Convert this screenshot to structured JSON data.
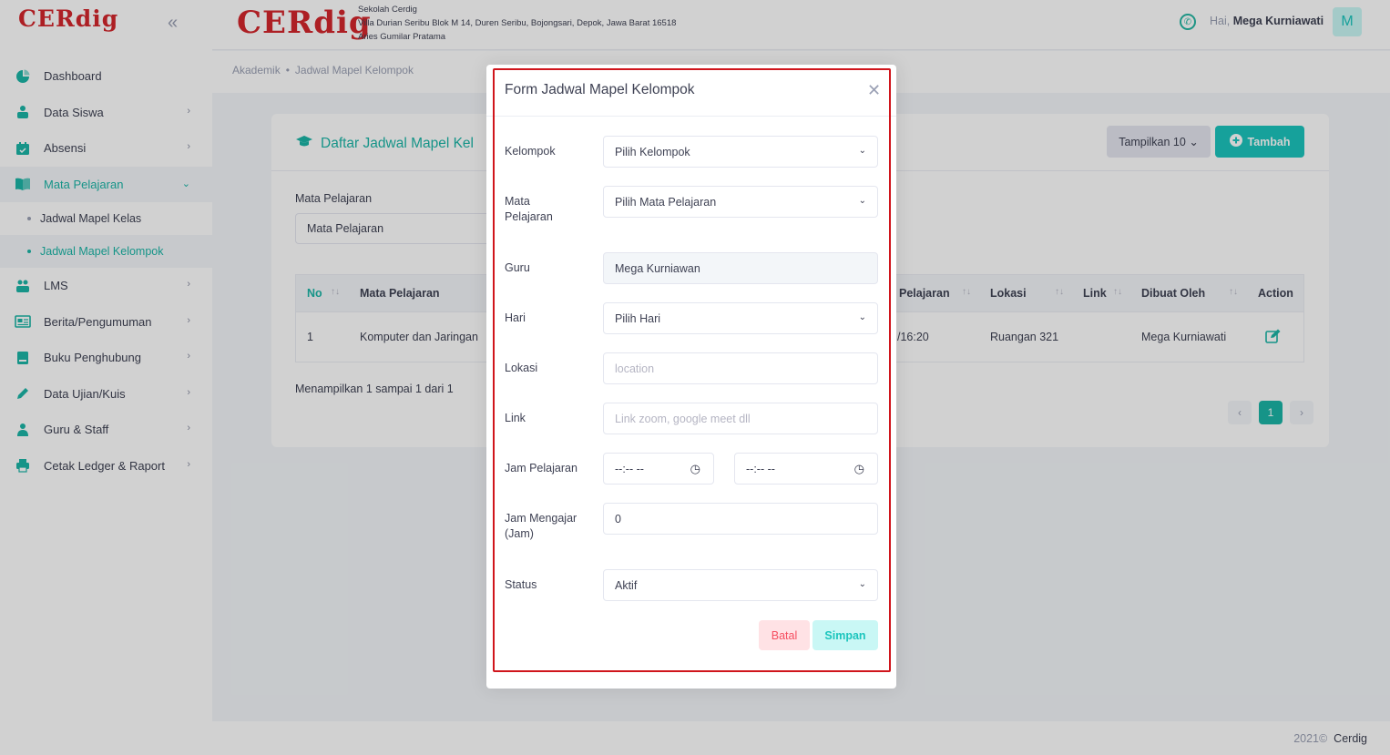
{
  "app": {
    "logo_text": "CERdig",
    "school_name": "Sekolah Cerdig",
    "school_address": "Villa Durian Seribu Blok M 14, Duren Seribu, Bojongsari, Depok, Jawa Barat 16518",
    "principal": "Aries Gumilar Pratama",
    "greeting": "Hai,",
    "user_name": "Mega Kurniawati",
    "avatar_letter": "M"
  },
  "sidebar": {
    "items": [
      {
        "label": "Dashboard",
        "icon": "dashboard-icon"
      },
      {
        "label": "Data Siswa",
        "icon": "student-icon"
      },
      {
        "label": "Absensi",
        "icon": "calendar-icon"
      },
      {
        "label": "Mata Pelajaran",
        "icon": "book-icon"
      },
      {
        "label": "Jadwal Mapel Kelas"
      },
      {
        "label": "Jadwal Mapel Kelompok"
      },
      {
        "label": "LMS",
        "icon": "lms-icon"
      },
      {
        "label": "Berita/Pengumuman",
        "icon": "news-icon"
      },
      {
        "label": "Buku Penghubung",
        "icon": "notebook-icon"
      },
      {
        "label": "Data Ujian/Kuis",
        "icon": "pencil-icon"
      },
      {
        "label": "Guru & Staff",
        "icon": "teacher-icon"
      },
      {
        "label": "Cetak Ledger & Raport",
        "icon": "printer-icon"
      }
    ]
  },
  "breadcrumb": [
    "Akademik",
    "Jadwal Mapel Kelompok"
  ],
  "page": {
    "title": "Daftar Jadwal Mapel Kel",
    "show_button": "Tampilkan 10",
    "add_button": "Tambah",
    "filter_label": "Mata Pelajaran",
    "filter_value": "Mata Pelajaran",
    "columns": [
      "No",
      "Mata Pelajaran",
      "Pelajaran",
      "Lokasi",
      "Link",
      "Dibuat Oleh",
      "Action"
    ],
    "row": {
      "no": "1",
      "mapel": "Komputer dan Jaringan",
      "jam": "/16:20",
      "lokasi": "Ruangan 321",
      "dibuat_oleh": "Mega Kurniawati"
    },
    "summary": "Menampilkan 1 sampai 1 dari 1",
    "current_page": "1"
  },
  "footer": {
    "year": "2021©",
    "brand": "Cerdig"
  },
  "modal": {
    "title": "Form Jadwal Mapel Kelompok",
    "kelompok_label": "Kelompok",
    "kelompok_value": "Pilih Kelompok",
    "mapel_label_1": "Mata",
    "mapel_label_2": "Pelajaran",
    "mapel_value": "Pilih Mata Pelajaran",
    "guru_label": "Guru",
    "guru_value": "Mega Kurniawan",
    "hari_label": "Hari",
    "hari_value": "Pilih Hari",
    "lokasi_label": "Lokasi",
    "lokasi_placeholder": "location",
    "link_label": "Link",
    "link_placeholder": "Link zoom, google meet dll",
    "jam_pelajaran_label": "Jam Pelajaran",
    "time_start": "--:-- --",
    "time_end": "--:-- --",
    "jam_mengajar_label_1": "Jam Mengajar",
    "jam_mengajar_label_2": "(Jam)",
    "jam_mengajar_value": "0",
    "status_label": "Status",
    "status_value": "Aktif",
    "cancel_button": "Batal",
    "save_button": "Simpan"
  },
  "colors": {
    "accent": "#1bb5a7",
    "brand_red": "#d3262c",
    "frame_red": "#d0151c"
  }
}
